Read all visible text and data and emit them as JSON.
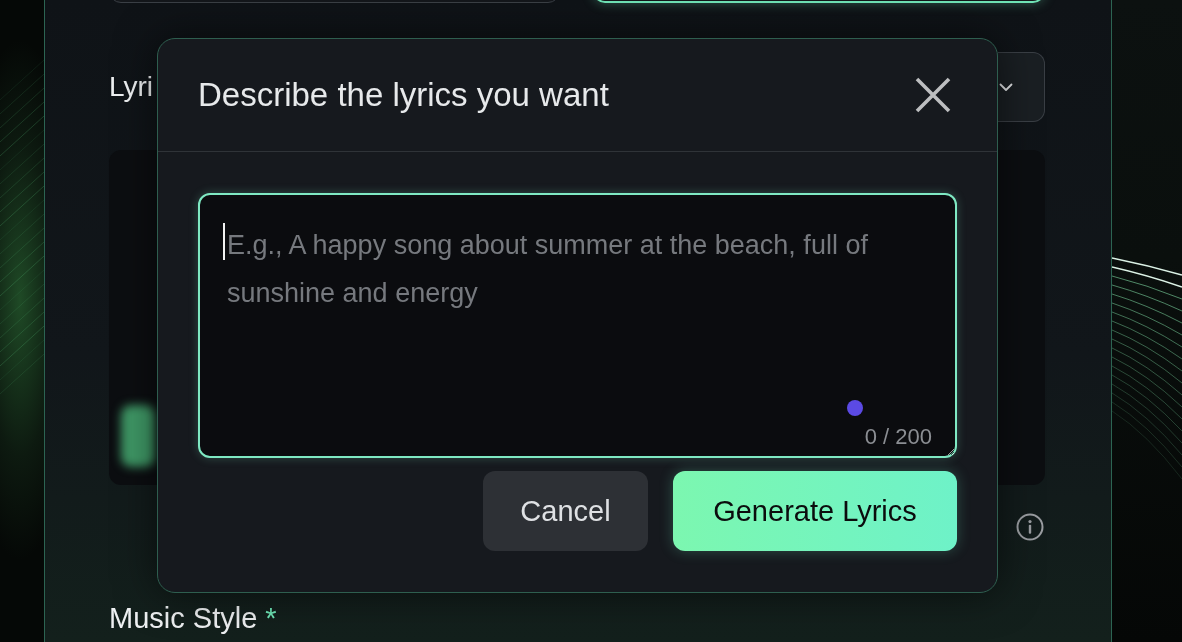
{
  "form": {
    "mode_options": [
      {
        "selected": false
      },
      {
        "selected": true
      }
    ],
    "lyrics_label": "Lyri",
    "style_label": {
      "text": "Music Style",
      "required_mark": "*"
    }
  },
  "dialog": {
    "title": "Describe the lyrics you want",
    "prompt_field": {
      "placeholder": "E.g., A happy song about summer at the beach, full of sunshine and energy",
      "counter": "0 / 200",
      "focused": true
    },
    "buttons": [
      {
        "label": "Cancel",
        "kind": "secondary"
      },
      {
        "label": "Generate Lyrics",
        "kind": "primary"
      }
    ]
  }
}
